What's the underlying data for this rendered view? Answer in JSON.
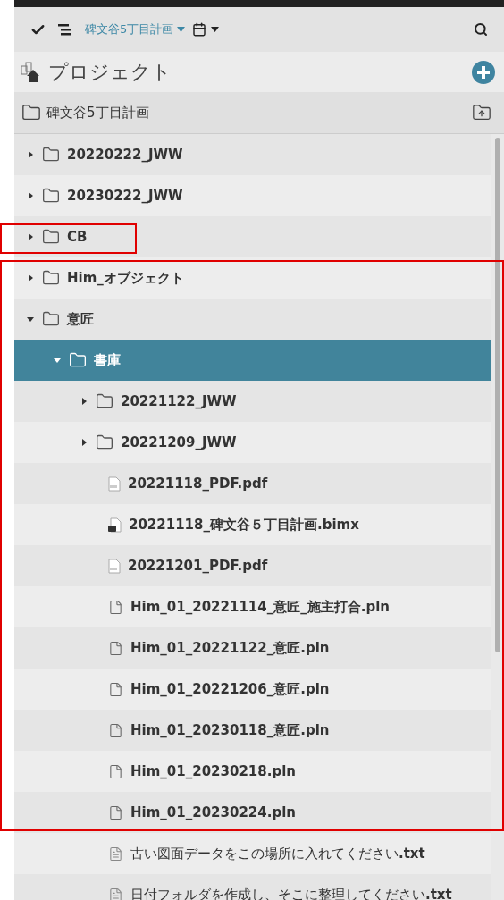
{
  "toolbar": {
    "project": "碑文谷5丁目計画"
  },
  "header": {
    "title": "プロジェクト"
  },
  "breadcrumb": {
    "folder": "碑文谷5丁目計画"
  },
  "tree": [
    {
      "name": "20220222_JWW",
      "kind": "folder",
      "expanded": false,
      "selected": false
    },
    {
      "name": "20230222_JWW",
      "kind": "folder",
      "expanded": false,
      "selected": false
    },
    {
      "name": "CB",
      "kind": "folder",
      "expanded": false,
      "selected": false
    },
    {
      "name": "Him_オブジェクト",
      "kind": "folder",
      "expanded": false,
      "selected": false
    },
    {
      "name": "意匠",
      "kind": "folder",
      "expanded": true,
      "selected": false,
      "children": [
        {
          "name": "書庫",
          "kind": "folder",
          "expanded": true,
          "selected": true,
          "children": [
            {
              "name": "20221122_JWW",
              "kind": "folder",
              "expanded": false,
              "selected": false
            },
            {
              "name": "20221209_JWW",
              "kind": "folder",
              "expanded": false,
              "selected": false
            },
            {
              "name": "20221118_PDF.pdf",
              "kind": "pdf",
              "selected": false
            },
            {
              "name": "20221118_碑文谷５丁目計画.bimx",
              "kind": "bimx",
              "selected": false
            },
            {
              "name": "20221201_PDF.pdf",
              "kind": "pdf",
              "selected": false
            },
            {
              "name": "Him_01_20221114_意匠_施主打合.pln",
              "kind": "file",
              "selected": false
            },
            {
              "name": "Him_01_20221122_意匠.pln",
              "kind": "file",
              "selected": false
            },
            {
              "name": "Him_01_20221206_意匠.pln",
              "kind": "file",
              "selected": false
            },
            {
              "name": "Him_01_20230118_意匠.pln",
              "kind": "file",
              "selected": false
            },
            {
              "name": "Him_01_20230218.pln",
              "kind": "file",
              "selected": false
            },
            {
              "name": "Him_01_20230224.pln",
              "kind": "file",
              "selected": false
            },
            {
              "name": "古い図面データをこの場所に入れてください**.txt**",
              "kind": "text",
              "selected": false
            },
            {
              "name": "日付フォルダを作成し、そこに整理してください**.txt**",
              "kind": "text",
              "selected": false
            }
          ]
        }
      ]
    }
  ]
}
